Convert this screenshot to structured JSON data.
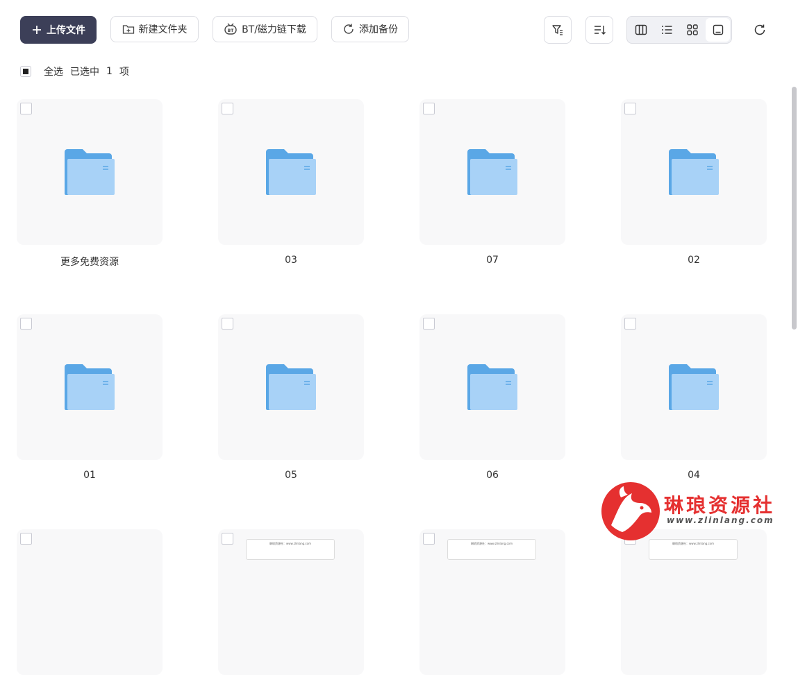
{
  "toolbar": {
    "upload_label": "上传文件",
    "new_folder_label": "新建文件夹",
    "bt_label": "BT/磁力链下载",
    "backup_label": "添加备份"
  },
  "selection": {
    "select_all_label": "全选",
    "selected_prefix": "已选中",
    "selected_count": "1",
    "selected_suffix": "项"
  },
  "files": [
    {
      "name": "更多免费资源",
      "type": "folder"
    },
    {
      "name": "03",
      "type": "folder"
    },
    {
      "name": "07",
      "type": "folder"
    },
    {
      "name": "02",
      "type": "folder"
    },
    {
      "name": "01",
      "type": "folder"
    },
    {
      "name": "05",
      "type": "folder"
    },
    {
      "name": "06",
      "type": "folder"
    },
    {
      "name": "04",
      "type": "folder"
    },
    {
      "name": "",
      "type": "partial"
    },
    {
      "name": "",
      "type": "doc",
      "preview_text": "琳琅资源社：www.zlinlang.com"
    },
    {
      "name": "",
      "type": "doc",
      "preview_text": "琳琅资源社：www.zlinlang.com"
    },
    {
      "name": "",
      "type": "doc",
      "preview_text": "琳琅资源社：www.zlinlang.com"
    }
  ],
  "watermark": {
    "title": "琳琅资源社",
    "url": "www.zlinlang.com"
  },
  "colors": {
    "primary": "#3c3f58",
    "folder": "#6fb6f0",
    "watermark": "#e53030"
  }
}
